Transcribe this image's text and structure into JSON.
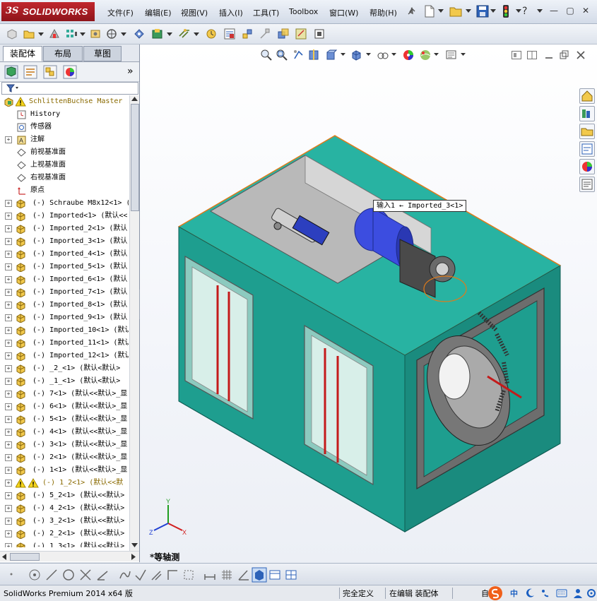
{
  "app": {
    "logo_ds": "3S",
    "logo_text": "SOLIDWORKS",
    "accent": "#c1272d"
  },
  "menu": [
    {
      "label": "文件(F)"
    },
    {
      "label": "编辑(E)"
    },
    {
      "label": "视图(V)"
    },
    {
      "label": "插入(I)"
    },
    {
      "label": "工具(T)"
    },
    {
      "label": "Toolbox"
    },
    {
      "label": "窗口(W)"
    },
    {
      "label": "帮助(H)"
    }
  ],
  "help_icon": "?",
  "window_controls": {
    "minimize": "—",
    "restore": "▢",
    "close": "✕"
  },
  "tabs": [
    {
      "label": "装配体",
      "active": true
    },
    {
      "label": "布局",
      "active": false
    },
    {
      "label": "草图",
      "active": false
    }
  ],
  "panel_more": "»",
  "tree": {
    "root": "SchlittenBuchse Master",
    "items": [
      {
        "label": "History",
        "expandable": false,
        "icon": "history-icon"
      },
      {
        "label": "传感器",
        "expandable": false,
        "icon": "sensor-icon"
      },
      {
        "label": "注解",
        "expandable": true,
        "icon": "annotation-icon"
      },
      {
        "label": "前视基准面",
        "expandable": false,
        "icon": "plane-icon"
      },
      {
        "label": "上视基准面",
        "expandable": false,
        "icon": "plane-icon"
      },
      {
        "label": "右视基准面",
        "expandable": false,
        "icon": "plane-icon"
      },
      {
        "label": "原点",
        "expandable": false,
        "icon": "origin-icon"
      },
      {
        "label": "(-) Schraube M8x12<1> (",
        "expandable": true,
        "icon": "part-icon"
      },
      {
        "label": "(-) Imported<1> (默认<<",
        "expandable": true,
        "icon": "part-icon"
      },
      {
        "label": "(-) Imported_2<1> (默认",
        "expandable": true,
        "icon": "part-icon"
      },
      {
        "label": "(-) Imported_3<1> (默认",
        "expandable": true,
        "icon": "part-icon"
      },
      {
        "label": "(-) Imported_4<1> (默认",
        "expandable": true,
        "icon": "part-icon"
      },
      {
        "label": "(-) Imported_5<1> (默认",
        "expandable": true,
        "icon": "part-icon"
      },
      {
        "label": "(-) Imported_6<1> (默认",
        "expandable": true,
        "icon": "part-icon"
      },
      {
        "label": "(-) Imported_7<1> (默认",
        "expandable": true,
        "icon": "part-icon"
      },
      {
        "label": "(-) Imported_8<1> (默认",
        "expandable": true,
        "icon": "part-icon"
      },
      {
        "label": "(-) Imported_9<1> (默认",
        "expandable": true,
        "icon": "part-icon"
      },
      {
        "label": "(-) Imported_10<1> (默认",
        "expandable": true,
        "icon": "part-icon"
      },
      {
        "label": "(-) Imported_11<1> (默认",
        "expandable": true,
        "icon": "part-icon"
      },
      {
        "label": "(-) Imported_12<1> (默认",
        "expandable": true,
        "icon": "part-icon"
      },
      {
        "label": "(-) _2_<1> (默认<默认>",
        "expandable": true,
        "icon": "part-icon"
      },
      {
        "label": "(-) _1_<1> (默认<默认>",
        "expandable": true,
        "icon": "part-icon"
      },
      {
        "label": "(-) 7<1> (默认<<默认>_显",
        "expandable": true,
        "icon": "part-icon"
      },
      {
        "label": "(-) 6<1> (默认<<默认>_显",
        "expandable": true,
        "icon": "part-icon"
      },
      {
        "label": "(-) 5<1> (默认<<默认>_显",
        "expandable": true,
        "icon": "part-icon"
      },
      {
        "label": "(-) 4<1> (默认<<默认>_显",
        "expandable": true,
        "icon": "part-icon"
      },
      {
        "label": "(-) 3<1> (默认<<默认>_显",
        "expandable": true,
        "icon": "part-icon"
      },
      {
        "label": "(-) 2<1> (默认<<默认>_显",
        "expandable": true,
        "icon": "part-icon"
      },
      {
        "label": "(-) 1<1> (默认<<默认>_显",
        "expandable": true,
        "icon": "part-icon"
      },
      {
        "label": "(-) 1_2<1> (默认<<默",
        "expandable": true,
        "icon": "warning-part-icon",
        "warning": true
      },
      {
        "label": "(-) 5_2<1> (默认<<默认>",
        "expandable": true,
        "icon": "part-icon"
      },
      {
        "label": "(-) 4_2<1> (默认<<默认>",
        "expandable": true,
        "icon": "part-icon"
      },
      {
        "label": "(-) 3_2<1> (默认<<默认>",
        "expandable": true,
        "icon": "part-icon"
      },
      {
        "label": "(-) 2_2<1> (默认<<默认>",
        "expandable": true,
        "icon": "part-icon"
      },
      {
        "label": "(-) 1_3<1> (默认<<默认>",
        "expandable": true,
        "icon": "part-icon"
      }
    ]
  },
  "viewport": {
    "tooltip": "输入1 ← Imported_3<1>",
    "view_name": "*等轴测",
    "triad": {
      "x": "X",
      "y": "Y",
      "z": "Z"
    }
  },
  "status": {
    "version": "SolidWorks Premium 2014 x64 版",
    "definition": "完全定义",
    "editing": "在编辑 装配体",
    "ime_label": "中",
    "ime_prefix": "自"
  },
  "colors": {
    "model_body": "#1e9e8f",
    "model_edge": "#e07b1a",
    "cylinder": "#3c4de0",
    "slot_red": "#c41a1a"
  }
}
